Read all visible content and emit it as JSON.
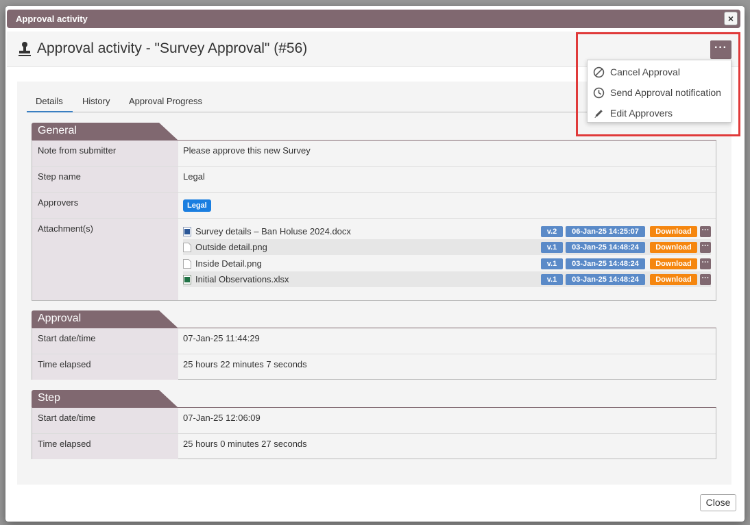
{
  "dialog": {
    "title": "Approval activity",
    "close_glyph": "×",
    "heading": "Approval activity - \"Survey Approval\" (#56)",
    "more_glyph": "···",
    "close_button": "Close"
  },
  "menu": {
    "items": [
      {
        "label": "Cancel Approval",
        "icon": "ban-icon"
      },
      {
        "label": "Send Approval notification",
        "icon": "clock-icon"
      },
      {
        "label": "Edit Approvers",
        "icon": "pencil-icon"
      }
    ]
  },
  "tabs": [
    {
      "label": "Details",
      "active": true
    },
    {
      "label": "History",
      "active": false
    },
    {
      "label": "Approval Progress",
      "active": false
    }
  ],
  "general": {
    "title": "General",
    "rows": [
      {
        "label": "Note from submitter",
        "value": "Please approve this new Survey"
      },
      {
        "label": "Step name",
        "value": "Legal"
      },
      {
        "label": "Approvers",
        "value": "Legal"
      },
      {
        "label": "Attachment(s)"
      }
    ],
    "attachments": [
      {
        "name": "Survey details – Ban Holuse 2024.docx",
        "icon": "word-file-icon",
        "version": "v.2",
        "date": "06-Jan-25 14:25:07",
        "download": "Download",
        "more": "···"
      },
      {
        "name": "Outside detail.png",
        "icon": "image-file-icon",
        "version": "v.1",
        "date": "03-Jan-25 14:48:24",
        "download": "Download",
        "more": "···"
      },
      {
        "name": "Inside Detail.png",
        "icon": "image-file-icon",
        "version": "v.1",
        "date": "03-Jan-25 14:48:24",
        "download": "Download",
        "more": "···"
      },
      {
        "name": "Initial Observations.xlsx",
        "icon": "excel-file-icon",
        "version": "v.1",
        "date": "03-Jan-25 14:48:24",
        "download": "Download",
        "more": "···"
      }
    ]
  },
  "approval": {
    "title": "Approval",
    "rows": [
      {
        "label": "Start date/time",
        "value": "07-Jan-25 11:44:29"
      },
      {
        "label": "Time elapsed",
        "value": "25 hours 22 minutes 7 seconds"
      }
    ]
  },
  "step": {
    "title": "Step",
    "rows": [
      {
        "label": "Start date/time",
        "value": "07-Jan-25 12:06:09"
      },
      {
        "label": "Time elapsed",
        "value": "25 hours 0 minutes 27 seconds"
      }
    ]
  },
  "colors": {
    "accent": "#806870",
    "highlight": "#e03a3a",
    "badge_blue": "#1a7ee0",
    "version_blue": "#5a8ac8",
    "download_orange": "#f5860f"
  }
}
